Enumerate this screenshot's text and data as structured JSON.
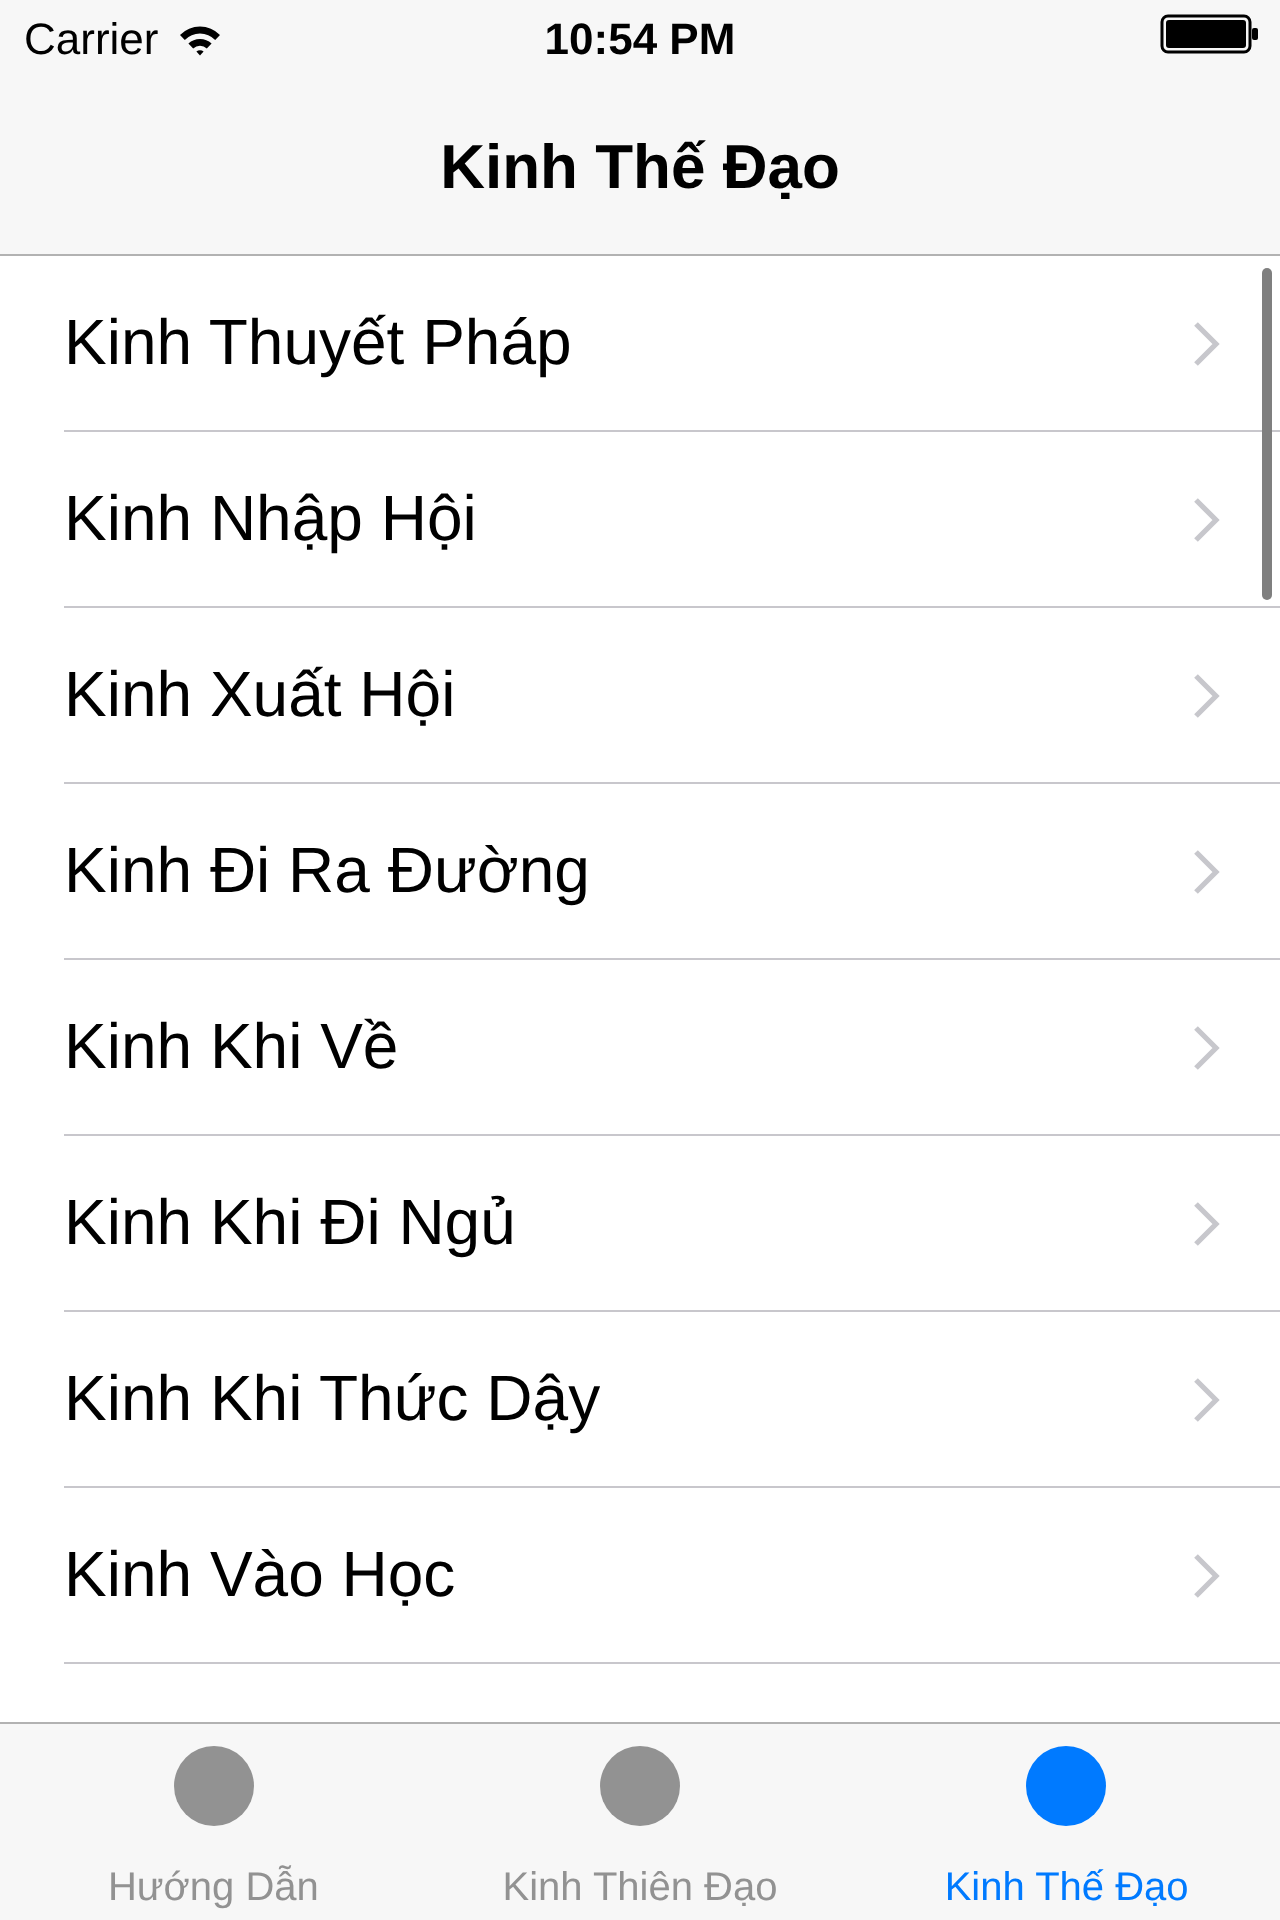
{
  "status_bar": {
    "carrier": "Carrier",
    "time": "10:54 PM"
  },
  "nav_bar": {
    "title": "Kinh Thế Đạo"
  },
  "list": [
    {
      "label": "Kinh Thuyết Pháp"
    },
    {
      "label": "Kinh Nhập Hội"
    },
    {
      "label": "Kinh Xuất Hội"
    },
    {
      "label": "Kinh Đi Ra Đường"
    },
    {
      "label": "Kinh Khi Về"
    },
    {
      "label": "Kinh Khi Đi Ngủ"
    },
    {
      "label": "Kinh Khi Thức Dậy"
    },
    {
      "label": "Kinh Vào Học"
    }
  ],
  "tab_bar": [
    {
      "label": "Hướng Dẫn",
      "selected": false
    },
    {
      "label": "Kinh Thiên Đạo",
      "selected": false
    },
    {
      "label": "Kinh Thế Đạo",
      "selected": true
    }
  ]
}
